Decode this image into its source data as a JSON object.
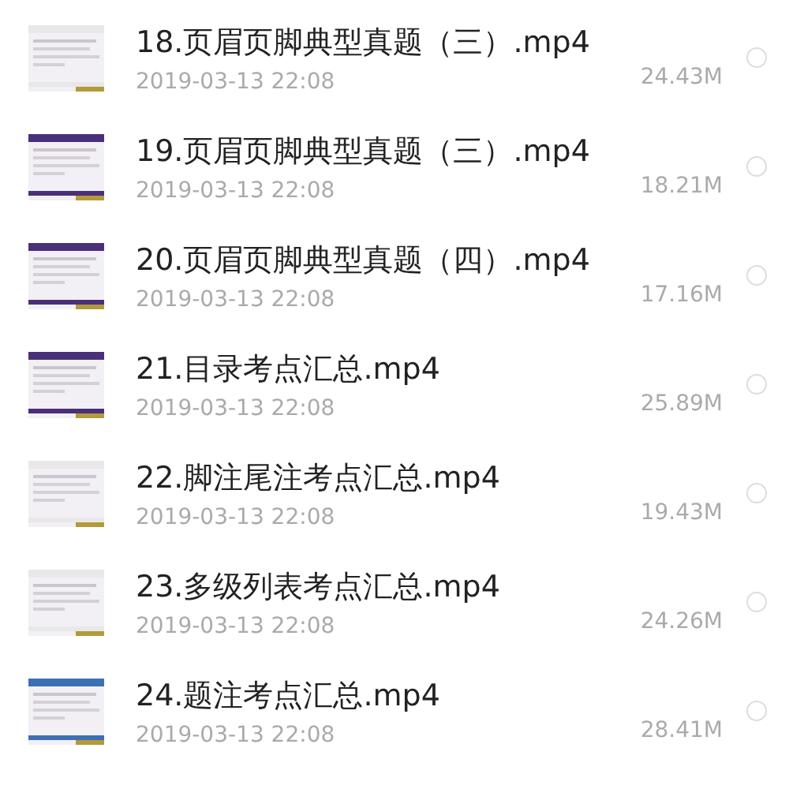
{
  "files": [
    {
      "name": "18.页眉页脚典型真题（三）.mp4",
      "date": "2019-03-13 22:08",
      "size": "24.43M",
      "selected": false
    },
    {
      "name": "19.页眉页脚典型真题（三）.mp4",
      "date": "2019-03-13 22:08",
      "size": "18.21M",
      "selected": false
    },
    {
      "name": "20.页眉页脚典型真题（四）.mp4",
      "date": "2019-03-13 22:08",
      "size": "17.16M",
      "selected": false
    },
    {
      "name": "21.目录考点汇总.mp4",
      "date": "2019-03-13 22:08",
      "size": "25.89M",
      "selected": false
    },
    {
      "name": "22.脚注尾注考点汇总.mp4",
      "date": "2019-03-13 22:08",
      "size": "19.43M",
      "selected": false
    },
    {
      "name": "23.多级列表考点汇总.mp4",
      "date": "2019-03-13 22:08",
      "size": "24.26M",
      "selected": false
    },
    {
      "name": "24.题注考点汇总.mp4",
      "date": "2019-03-13 22:08",
      "size": "28.41M",
      "selected": false
    }
  ]
}
